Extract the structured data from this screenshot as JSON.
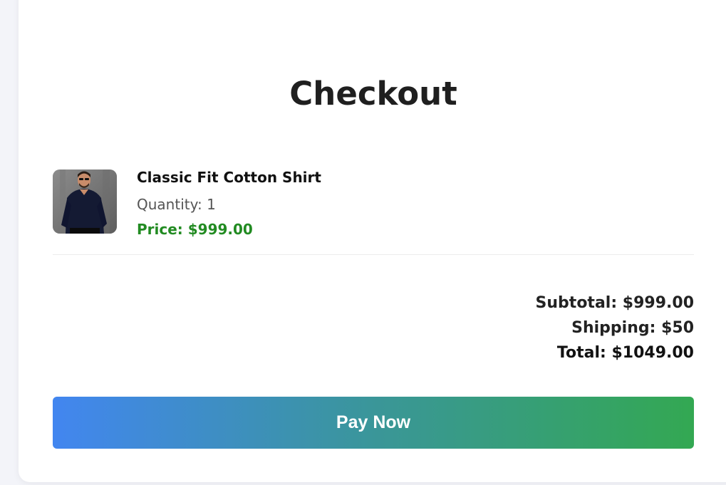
{
  "page": {
    "title": "Checkout"
  },
  "item": {
    "name": "Classic Fit Cotton Shirt",
    "quantity_text": "Quantity: 1",
    "price_text": "Price: $999.00",
    "price_color": "#228b22"
  },
  "summary": {
    "subtotal_text": "Subtotal: $999.00",
    "shipping_text": "Shipping: $50",
    "total_text": "Total: $1049.00"
  },
  "actions": {
    "pay_label": "Pay Now",
    "pay_gradient": [
      "#4286f0",
      "#33a852"
    ]
  }
}
